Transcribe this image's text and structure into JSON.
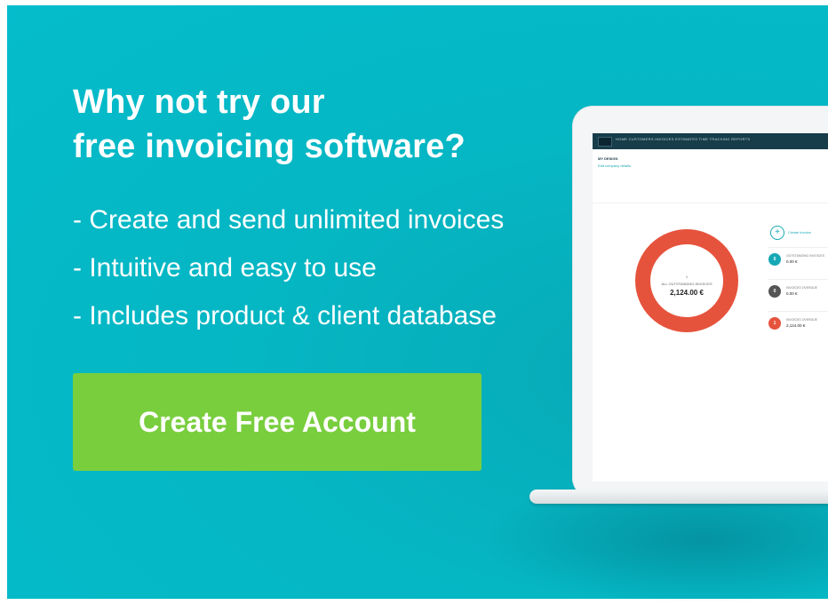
{
  "banner": {
    "headline_line1": "Why not try our",
    "headline_line2": "free invoicing software?",
    "bullets": [
      "- Create and send unlimited invoices",
      "- Intuitive and easy to use",
      "- Includes product & client database"
    ],
    "cta_label": "Create Free Account",
    "colors": {
      "background": "#05b6c3",
      "cta": "#79ce3e",
      "text": "#ffffff"
    }
  },
  "laptop_screen": {
    "nav_items": "HOME   CUSTOMERS   INVOICES   ESTIMATES   TIME TRACKING   REPORTS",
    "company_name": "MY DESIGN",
    "company_link": "Edit company details",
    "donut": {
      "count": "1",
      "label": "ALL OUTSTANDING INVOICES",
      "amount": "2,124.00 €",
      "color": "#e6533c"
    },
    "create_invoice_label": "Create Invoice",
    "stats": [
      {
        "count": "0",
        "label": "OUTSTANDING INVOICES",
        "value": "0.00 €",
        "color": "#17a8b5"
      },
      {
        "count": "0",
        "label": "INVOICES OVERDUE",
        "value": "0.00 €",
        "color": "#555555"
      },
      {
        "count": "1",
        "label": "INVOICES OVERDUE",
        "value": "2,124.00 €",
        "color": "#e6533c"
      }
    ]
  }
}
